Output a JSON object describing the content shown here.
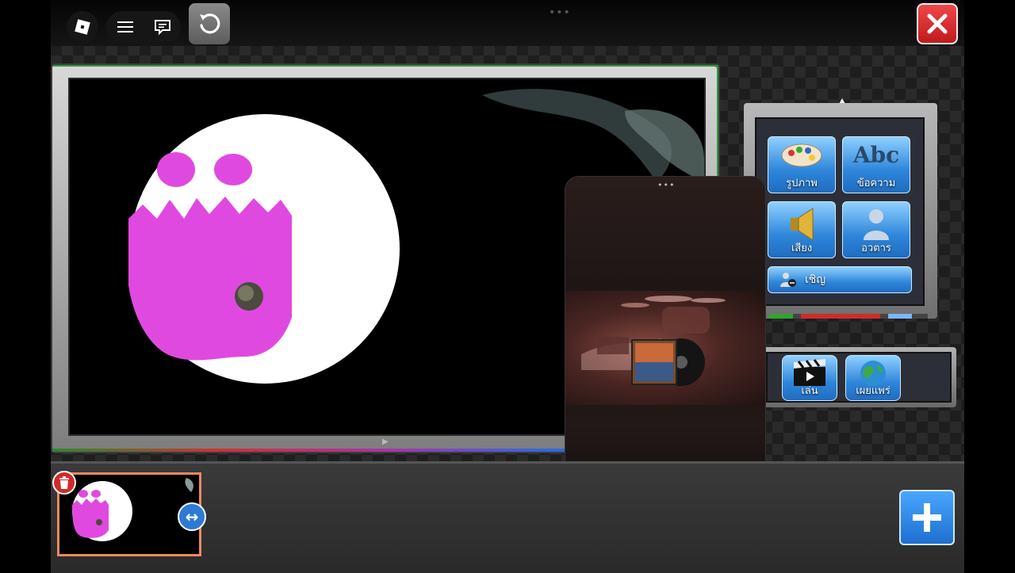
{
  "toolbar": {
    "roblox_icon": "roblox-logo-icon",
    "menu_icon": "hamburger-icon",
    "chat_icon": "chat-icon",
    "reset_icon": "undo-icon",
    "close_icon": "close-icon"
  },
  "tools": {
    "image_label": "รูปภาพ",
    "text_label": "ข้อความ",
    "text_tile_glyph": "Abc",
    "sound_label": "เสียง",
    "avatar_label": "อวตาร",
    "invite_label": "เชิญ"
  },
  "actions": {
    "play_label": "เล่น",
    "publish_label": "เผยแพร่"
  },
  "colors": {
    "accent_blue": "#2e86da",
    "close_red": "#d9292b",
    "thumb_border": "#f08a5a",
    "ghost_magenta": "#e049e0"
  }
}
